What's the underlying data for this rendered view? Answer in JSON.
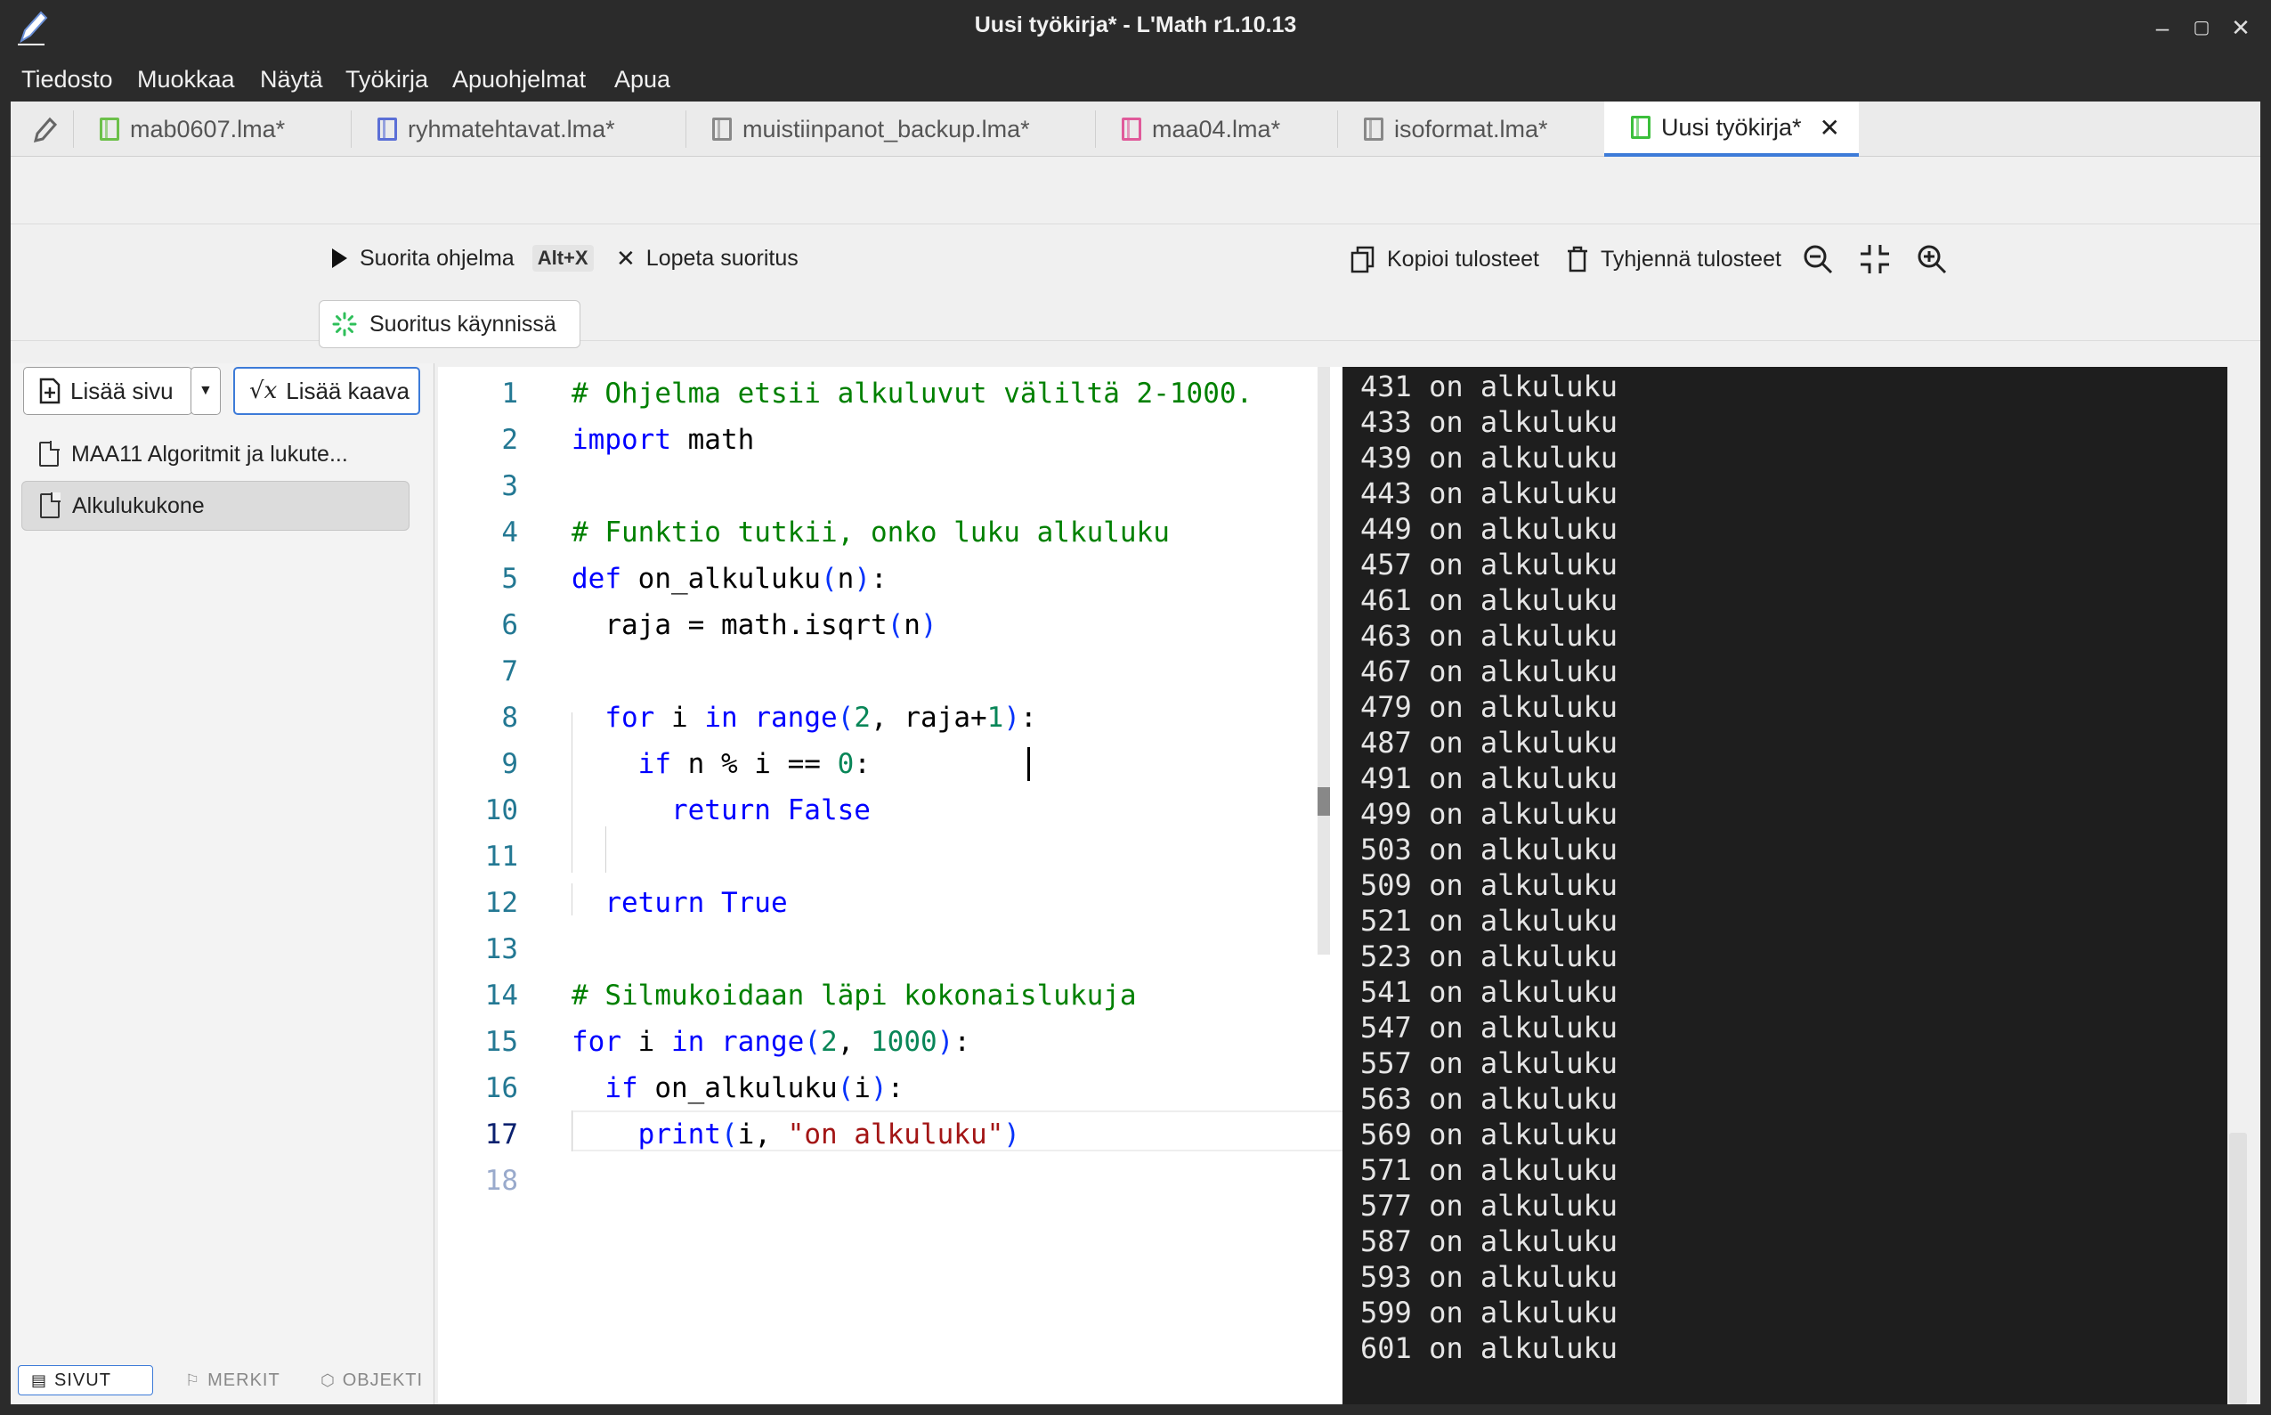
{
  "window": {
    "title": "Uusi työkirja* - L'Math r1.10.13"
  },
  "menu": [
    "Tiedosto",
    "Muokkaa",
    "Näytä",
    "Työkirja",
    "Apuohjelmat",
    "Apua"
  ],
  "tabs": [
    {
      "label": "mab0607.lma*",
      "color": "#6cc04a"
    },
    {
      "label": "ryhmatehtavat.lma*",
      "color": "#5b6fd6"
    },
    {
      "label": "muistiinpanot_backup.lma*",
      "color": "#888888"
    },
    {
      "label": "maa04.lma*",
      "color": "#e05a9a"
    },
    {
      "label": "isoformat.lma*",
      "color": "#888888"
    },
    {
      "label": "Uusi työkirja*",
      "color": "#3cbf3c",
      "active": true
    }
  ],
  "toolbar": {
    "run_label": "Suorita ohjelma",
    "run_shortcut": "Alt+X",
    "stop_label": "Lopeta suoritus",
    "copy_label": "Kopioi tulosteet",
    "clear_label": "Tyhjennä tulosteet",
    "running_label": "Suoritus käynnissä"
  },
  "sidebar": {
    "add_page": "Lisää sivu",
    "add_formula": "Lisää kaava",
    "pages": [
      {
        "label": "MAA11 Algoritmit ja lukute..."
      },
      {
        "label": "Alkulukukone",
        "selected": true
      }
    ],
    "bottom_tabs": [
      "SIVUT",
      "MERKIT",
      "OBJEKTI"
    ]
  },
  "editor": {
    "current_line": 17,
    "lines": [
      "# Ohjelma etsii alkuluvut väliltä 2-1000.",
      "import math",
      "",
      "# Funktio tutkii, onko luku alkuluku",
      "def on_alkuluku(n):",
      "  raja = math.isqrt(n)",
      "",
      "  for i in range(2, raja+1):",
      "    if n % i == 0:",
      "      return False",
      "",
      "  return True",
      "",
      "# Silmukoidaan läpi kokonaislukuja",
      "for i in range(2, 1000):",
      "  if on_alkuluku(i):",
      "    print(i, \"on alkuluku\")",
      ""
    ]
  },
  "console": {
    "lines": [
      "431 on alkuluku",
      "433 on alkuluku",
      "439 on alkuluku",
      "443 on alkuluku",
      "449 on alkuluku",
      "457 on alkuluku",
      "461 on alkuluku",
      "463 on alkuluku",
      "467 on alkuluku",
      "479 on alkuluku",
      "487 on alkuluku",
      "491 on alkuluku",
      "499 on alkuluku",
      "503 on alkuluku",
      "509 on alkuluku",
      "521 on alkuluku",
      "523 on alkuluku",
      "541 on alkuluku",
      "547 on alkuluku",
      "557 on alkuluku",
      "563 on alkuluku",
      "569 on alkuluku",
      "571 on alkuluku",
      "577 on alkuluku",
      "587 on alkuluku",
      "593 on alkuluku",
      "599 on alkuluku",
      "601 on alkuluku"
    ]
  },
  "icons": {
    "app": "pen-icon",
    "run": "play-icon",
    "stop": "close-icon",
    "copy": "copy-icon",
    "clear": "trash-icon",
    "zoom_out": "zoom-out-icon",
    "fit": "collapse-icon",
    "zoom_in": "zoom-in-icon",
    "running": "spinner-icon"
  },
  "colors": {
    "accent": "#3d7bd8",
    "console_bg": "#1e1e1e",
    "comment": "#008000",
    "keyword": "#0000ff"
  }
}
